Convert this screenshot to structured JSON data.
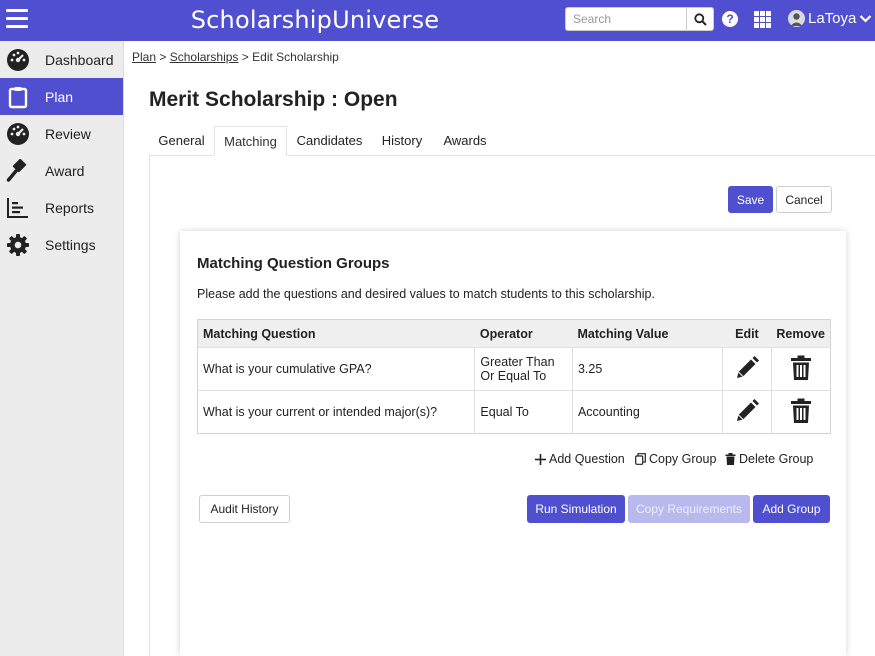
{
  "header": {
    "brand": "ScholarshipUniverse",
    "search_placeholder": "Search",
    "user_name": "LaToya",
    "help_glyph": "?"
  },
  "sidebar": {
    "items": [
      {
        "label": "Dashboard",
        "icon": "gauge-icon"
      },
      {
        "label": "Plan",
        "icon": "clipboard-icon"
      },
      {
        "label": "Review",
        "icon": "gauge-icon"
      },
      {
        "label": "Award",
        "icon": "gavel-icon"
      },
      {
        "label": "Reports",
        "icon": "bar-chart-icon"
      },
      {
        "label": "Settings",
        "icon": "gear-icon"
      }
    ],
    "active": "Plan",
    "active_color": "#4f4fcf"
  },
  "breadcrumb": {
    "plan": "Plan",
    "scholarships": "Scholarships",
    "sep": ">",
    "current": "Edit Scholarship"
  },
  "page": {
    "title": "Merit Scholarship : Open"
  },
  "tabs": [
    {
      "label": "General"
    },
    {
      "label": "Matching"
    },
    {
      "label": "Candidates"
    },
    {
      "label": "History"
    },
    {
      "label": "Awards"
    }
  ],
  "active_tab": "Matching",
  "form_buttons": {
    "save": "Save",
    "cancel": "Cancel"
  },
  "matching": {
    "title": "Matching Question Groups",
    "description": "Please add the questions and desired values to match students to this scholarship.",
    "columns": {
      "question": "Matching Question",
      "operator": "Operator",
      "value": "Matching Value",
      "edit": "Edit",
      "remove": "Remove"
    },
    "rows": [
      {
        "question": "What is your cumulative GPA?",
        "operator_line1": "Greater Than",
        "operator_line2": "Or Equal To",
        "value": "3.25"
      },
      {
        "question": "What is your current or intended major(s)?",
        "operator_line1": "Equal To",
        "operator_line2": "",
        "value": "Accounting"
      }
    ],
    "add_question": "Add Question",
    "copy_group": "Copy Group",
    "delete_group": "Delete Group",
    "audit_history": "Audit History",
    "run_simulation": "Run Simulation",
    "copy_requirements": "Copy Requirements",
    "add_group": "Add Group"
  },
  "colors": {
    "primary": "#4f4fcf",
    "primary_disabled": "#b9b9ee"
  }
}
